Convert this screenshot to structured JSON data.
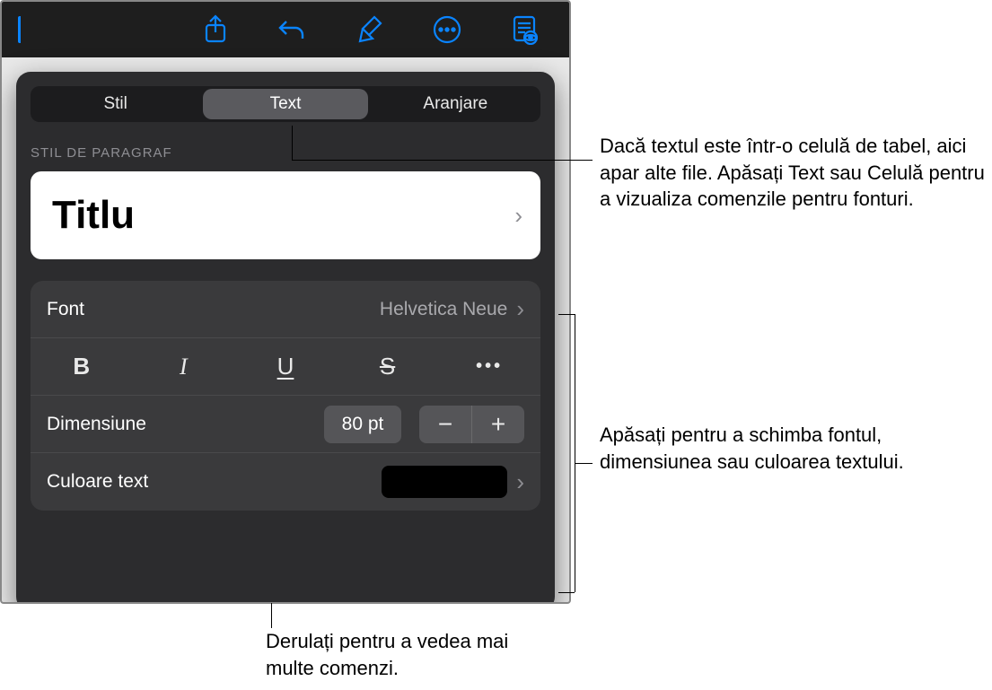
{
  "toolbar": {
    "buttons": {
      "share": "share-icon",
      "undo": "undo-icon",
      "format": "brush-icon",
      "more": "more-icon",
      "view": "page-mode-icon"
    }
  },
  "tabs": {
    "style": "Stil",
    "text": "Text",
    "arrange": "Aranjare"
  },
  "sections": {
    "paragraph_style_label": "STIL DE PARAGRAF"
  },
  "paragraph_style": {
    "name": "Titlu"
  },
  "font": {
    "label": "Font",
    "value": "Helvetica Neue"
  },
  "style_buttons": {
    "bold": "B",
    "italic": "I",
    "underline": "U",
    "strike": "S",
    "more": "•••"
  },
  "size": {
    "label": "Dimensiune",
    "value": "80 pt"
  },
  "text_color": {
    "label": "Culoare text",
    "value": "#000000"
  },
  "annotations": {
    "tabs_note": "Dacă textul este într-o celulă de tabel, aici apar alte file. Apăsați Text sau Celulă pentru a vizualiza comenzile pentru fonturi.",
    "font_note": "Apăsați pentru a schimba fontul, dimensiunea sau culoarea textului.",
    "scroll_note": "Derulați pentru a vedea mai multe comenzi."
  }
}
